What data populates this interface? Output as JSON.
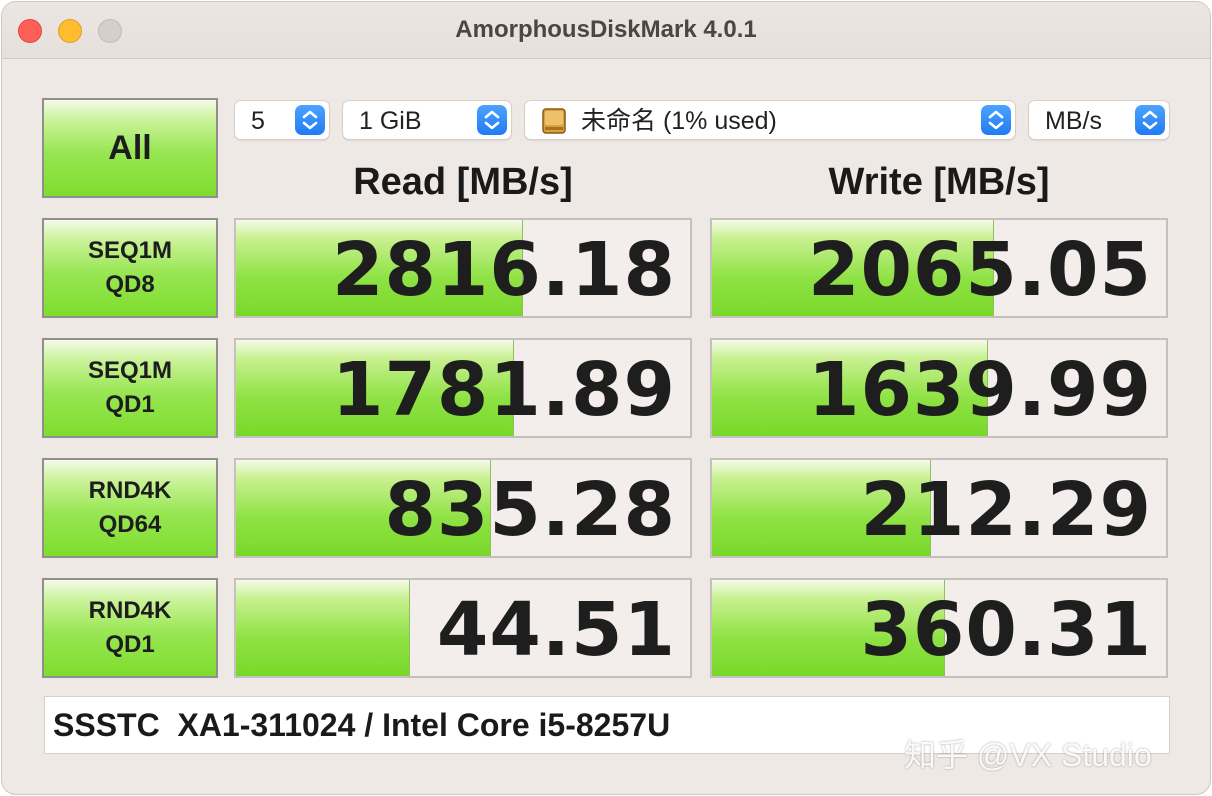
{
  "window": {
    "title": "AmorphousDiskMark 4.0.1"
  },
  "toolbar": {
    "all_label": "All",
    "count_value": "5",
    "size_value": "1 GiB",
    "drive_value": "未命名 (1% used)",
    "unit_value": "MB/s"
  },
  "headers": {
    "read": "Read [MB/s]",
    "write": "Write [MB/s]"
  },
  "tests": [
    {
      "line1": "SEQ1M",
      "line2": "QD8",
      "read": "2816.18",
      "write": "2065.05",
      "read_fill": 0.63,
      "write_fill": 0.62
    },
    {
      "line1": "SEQ1M",
      "line2": "QD1",
      "read": "1781.89",
      "write": "1639.99",
      "read_fill": 0.61,
      "write_fill": 0.606
    },
    {
      "line1": "RND4K",
      "line2": "QD64",
      "read": "835.28",
      "write": "212.29",
      "read_fill": 0.56,
      "write_fill": 0.48
    },
    {
      "line1": "RND4K",
      "line2": "QD1",
      "read": "44.51",
      "write": "360.31",
      "read_fill": 0.38,
      "write_fill": 0.51
    }
  ],
  "info_text": "SSSTC  XA1-311024 / Intel Core i5-8257U",
  "watermark_text": "知乎 @VX Studio",
  "colors": {
    "bar_green": "#8fe245",
    "close": "#fe5f57",
    "minimize": "#febc2e",
    "stepper_blue": "#1f7cf2"
  }
}
